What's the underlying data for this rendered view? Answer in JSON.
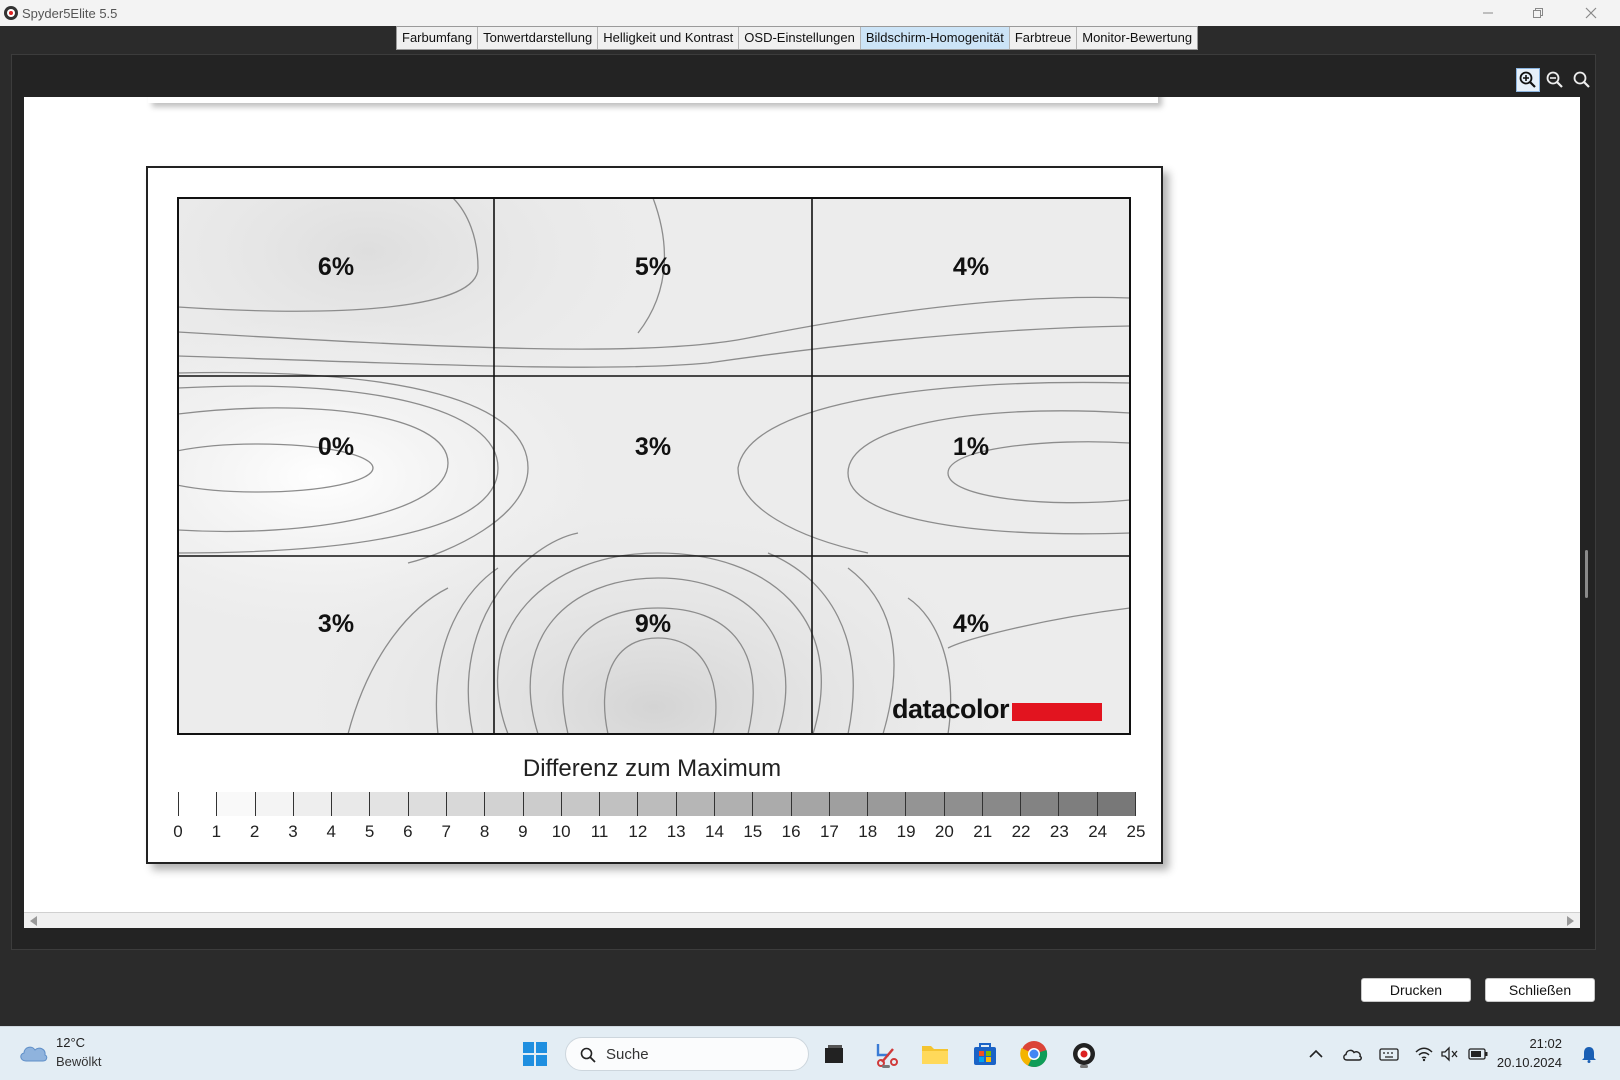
{
  "window": {
    "title": "Spyder5Elite 5.5"
  },
  "tabs": [
    {
      "label": "Farbumfang"
    },
    {
      "label": "Tonwertdarstellung"
    },
    {
      "label": "Helligkeit und Kontrast"
    },
    {
      "label": "OSD-Einstellungen"
    },
    {
      "label": "Bildschirm-Homogenität",
      "active": true
    },
    {
      "label": "Farbtreue"
    },
    {
      "label": "Monitor-Bewertung"
    }
  ],
  "toolbar": {
    "icons": [
      "zoom-in-icon",
      "zoom-out-icon",
      "zoom-fit-icon"
    ]
  },
  "report": {
    "grid_values": [
      [
        "6%",
        "5%",
        "4%"
      ],
      [
        "0%",
        "3%",
        "1%"
      ],
      [
        "3%",
        "9%",
        "4%"
      ]
    ],
    "logo_text": "datacolor",
    "legend_title": "Differenz zum Maximum",
    "legend_ticks": [
      "0",
      "1",
      "2",
      "3",
      "4",
      "5",
      "6",
      "7",
      "8",
      "9",
      "10",
      "11",
      "12",
      "13",
      "14",
      "15",
      "16",
      "17",
      "18",
      "19",
      "20",
      "21",
      "22",
      "23",
      "24",
      "25"
    ]
  },
  "buttons": {
    "print": "Drucken",
    "close": "Schließen"
  },
  "taskbar": {
    "weather_temp": "12°C",
    "weather_desc": "Bewölkt",
    "search_placeholder": "Suche",
    "time": "21:02",
    "date": "20.10.2024"
  },
  "colors": {
    "active_tab": "#cce4f7",
    "logo_red": "#e2141f"
  }
}
